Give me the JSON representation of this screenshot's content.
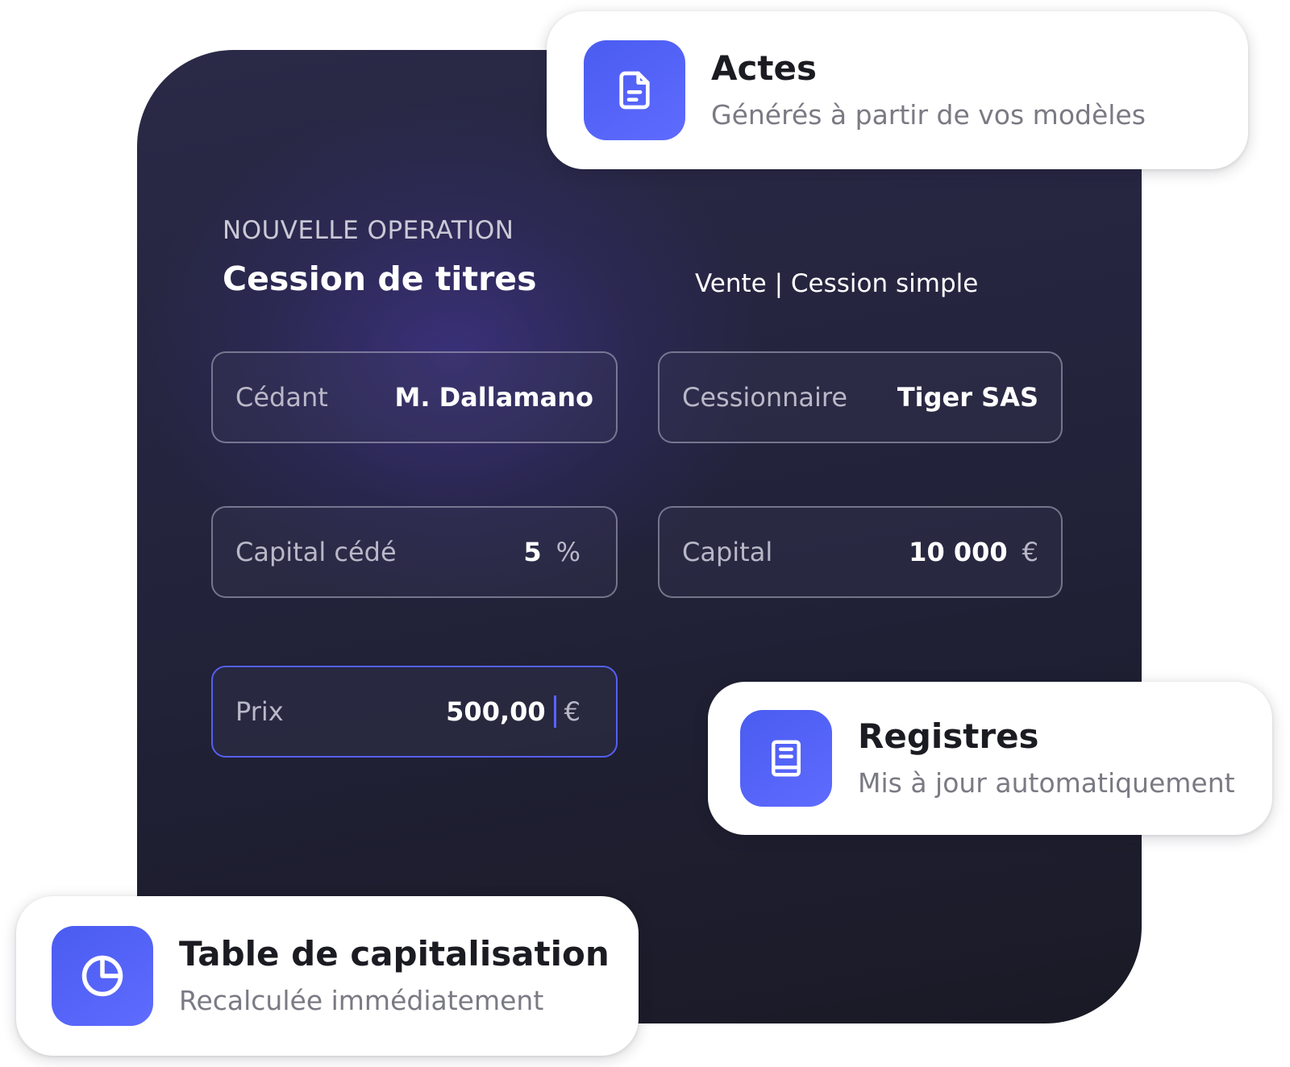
{
  "operation": {
    "overline": "NOUVELLE OPERATION",
    "title": "Cession de titres",
    "subtitle": "Vente | Cession simple"
  },
  "fields": {
    "cedant": {
      "label": "Cédant",
      "value": "M. Dallamano"
    },
    "cessionnaire": {
      "label": "Cessionnaire",
      "value": "Tiger SAS"
    },
    "capital_cede": {
      "label": "Capital cédé",
      "value": "5",
      "unit": "%"
    },
    "capital": {
      "label": "Capital",
      "value": "10 000",
      "unit": "€"
    },
    "prix": {
      "label": "Prix",
      "value": "500,00",
      "unit": "€"
    }
  },
  "cards": {
    "actes": {
      "title": "Actes",
      "subtitle": "Générés à partir de vos modèles",
      "icon": "document-icon"
    },
    "registres": {
      "title": "Registres",
      "subtitle": "Mis à jour automatiquement",
      "icon": "book-icon"
    },
    "table": {
      "title": "Table de capitalisation",
      "subtitle": "Recalculée immédiatement",
      "icon": "pie-chart-icon"
    }
  },
  "colors": {
    "accent": "#5560f0",
    "panel_dark": "#1a1a26",
    "panel_glow": "#4a3aa8"
  }
}
